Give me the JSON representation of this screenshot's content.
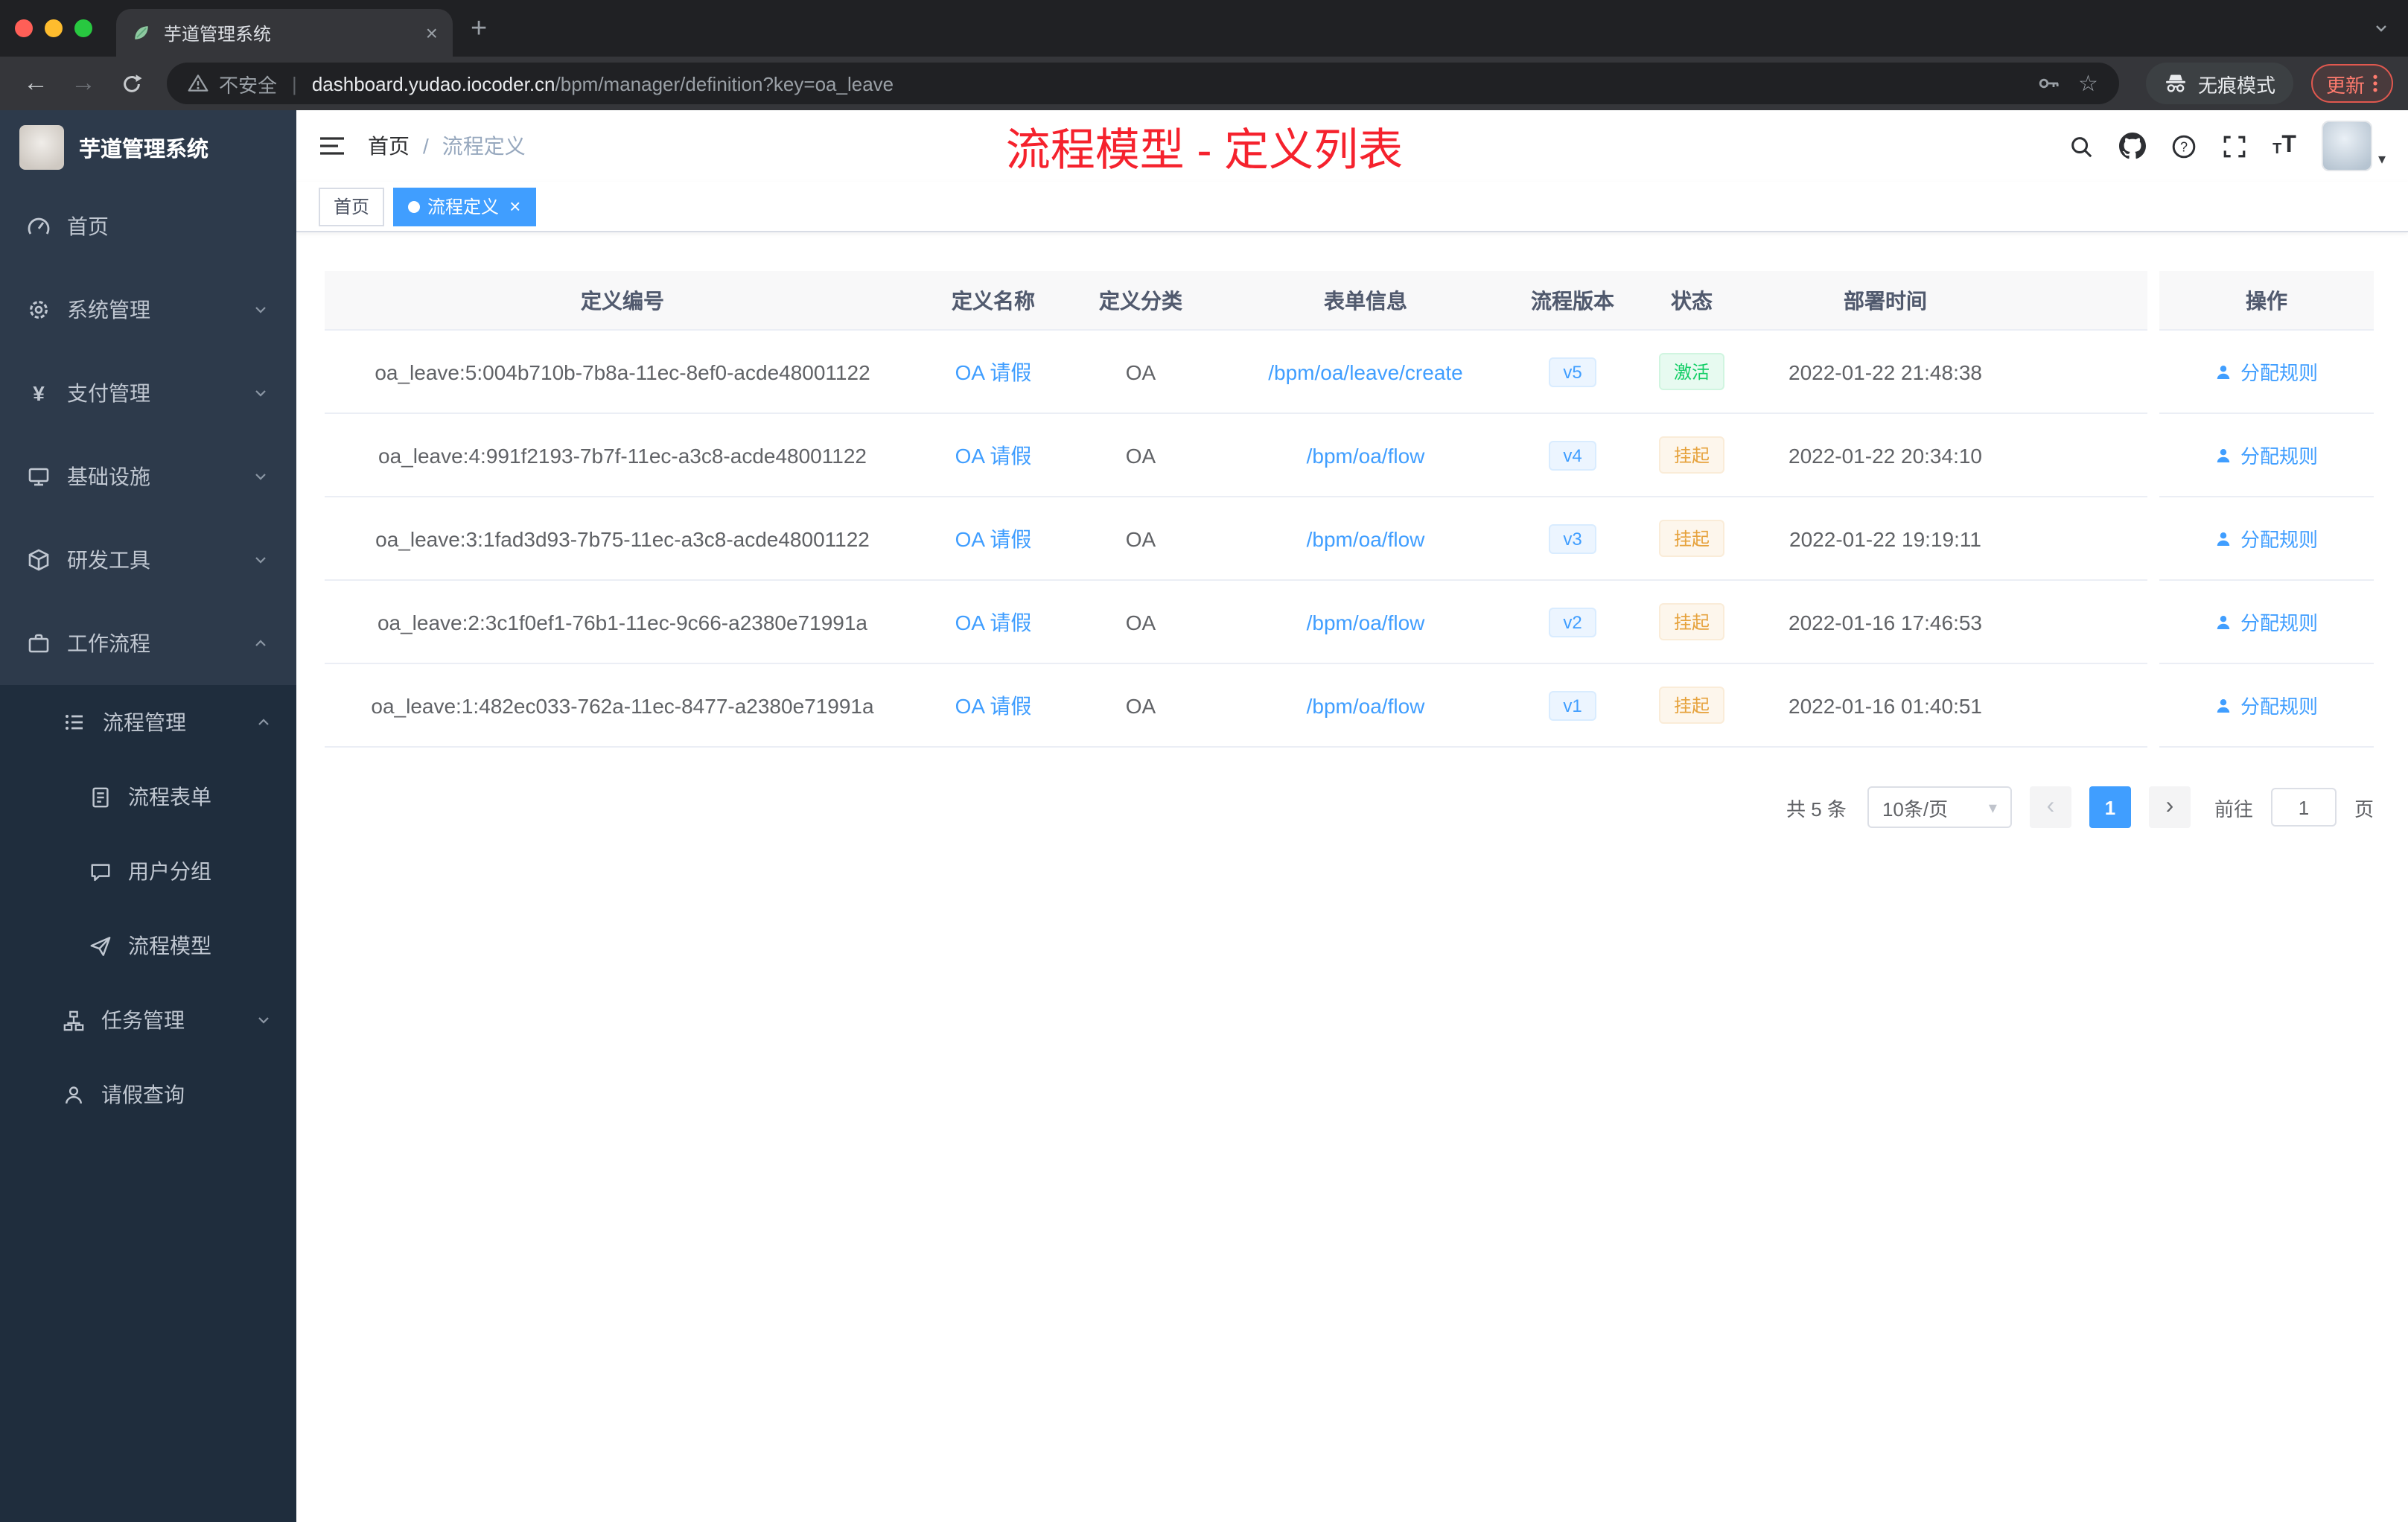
{
  "colors": {
    "accent": "#409eff",
    "success": "#13ce66",
    "warning": "#e6a23c",
    "title_red": "#f5222d",
    "sidebar_bg": "#2d3a4b",
    "submenu_bg": "#1f2d3d"
  },
  "glyphs": {
    "close": "×",
    "plus": "+",
    "back": "←",
    "forward": "→",
    "star": "☆",
    "caret_down": "▾",
    "prev": "‹",
    "next": "›",
    "yen": "¥",
    "pipe": "|",
    "t_small": "T",
    "t_big": "T"
  },
  "browser": {
    "tab_title": "芋道管理系统",
    "security_label": "不安全",
    "url_host": "dashboard.yudao.iocoder.cn",
    "url_path": "/bpm/manager/definition?key=oa_leave",
    "incognito_label": "无痕模式",
    "update_label": "更新"
  },
  "sidebar": {
    "logo_title": "芋道管理系统",
    "items": [
      {
        "label": "首页"
      },
      {
        "label": "系统管理"
      },
      {
        "label": "支付管理"
      },
      {
        "label": "基础设施"
      },
      {
        "label": "研发工具"
      },
      {
        "label": "工作流程"
      }
    ],
    "process_menu": {
      "label": "流程管理"
    },
    "process_children": [
      {
        "label": "流程表单"
      },
      {
        "label": "用户分组"
      },
      {
        "label": "流程模型"
      }
    ],
    "task_menu": {
      "label": "任务管理"
    },
    "leave_query": {
      "label": "请假查询"
    }
  },
  "navbar": {
    "breadcrumb_home": "首页",
    "breadcrumb_sep": "/",
    "breadcrumb_current": "流程定义",
    "page_title": "流程模型 - 定义列表"
  },
  "tags": {
    "home": "首页",
    "active": "流程定义"
  },
  "table": {
    "columns": [
      "定义编号",
      "定义名称",
      "定义分类",
      "表单信息",
      "流程版本",
      "状态",
      "部署时间",
      "操作"
    ],
    "rows": [
      {
        "id": "oa_leave:5:004b710b-7b8a-11ec-8ef0-acde48001122",
        "name": "OA 请假",
        "category": "OA",
        "form": "/bpm/oa/leave/create",
        "version": "v5",
        "status": "激活",
        "time": "2022-01-22 21:48:38",
        "action": "分配规则"
      },
      {
        "id": "oa_leave:4:991f2193-7b7f-11ec-a3c8-acde48001122",
        "name": "OA 请假",
        "category": "OA",
        "form": "/bpm/oa/flow",
        "version": "v4",
        "status": "挂起",
        "time": "2022-01-22 20:34:10",
        "action": "分配规则"
      },
      {
        "id": "oa_leave:3:1fad3d93-7b75-11ec-a3c8-acde48001122",
        "name": "OA 请假",
        "category": "OA",
        "form": "/bpm/oa/flow",
        "version": "v3",
        "status": "挂起",
        "time": "2022-01-22 19:19:11",
        "action": "分配规则"
      },
      {
        "id": "oa_leave:2:3c1f0ef1-76b1-11ec-9c66-a2380e71991a",
        "name": "OA 请假",
        "category": "OA",
        "form": "/bpm/oa/flow",
        "version": "v2",
        "status": "挂起",
        "time": "2022-01-16 17:46:53",
        "action": "分配规则"
      },
      {
        "id": "oa_leave:1:482ec033-762a-11ec-8477-a2380e71991a",
        "name": "OA 请假",
        "category": "OA",
        "form": "/bpm/oa/flow",
        "version": "v1",
        "status": "挂起",
        "time": "2022-01-16 01:40:51",
        "action": "分配规则"
      }
    ]
  },
  "pagination": {
    "total": "共 5 条",
    "page_size": "10条/页",
    "current": "1",
    "goto_label": "前往",
    "goto_value": "1",
    "unit": "页"
  }
}
